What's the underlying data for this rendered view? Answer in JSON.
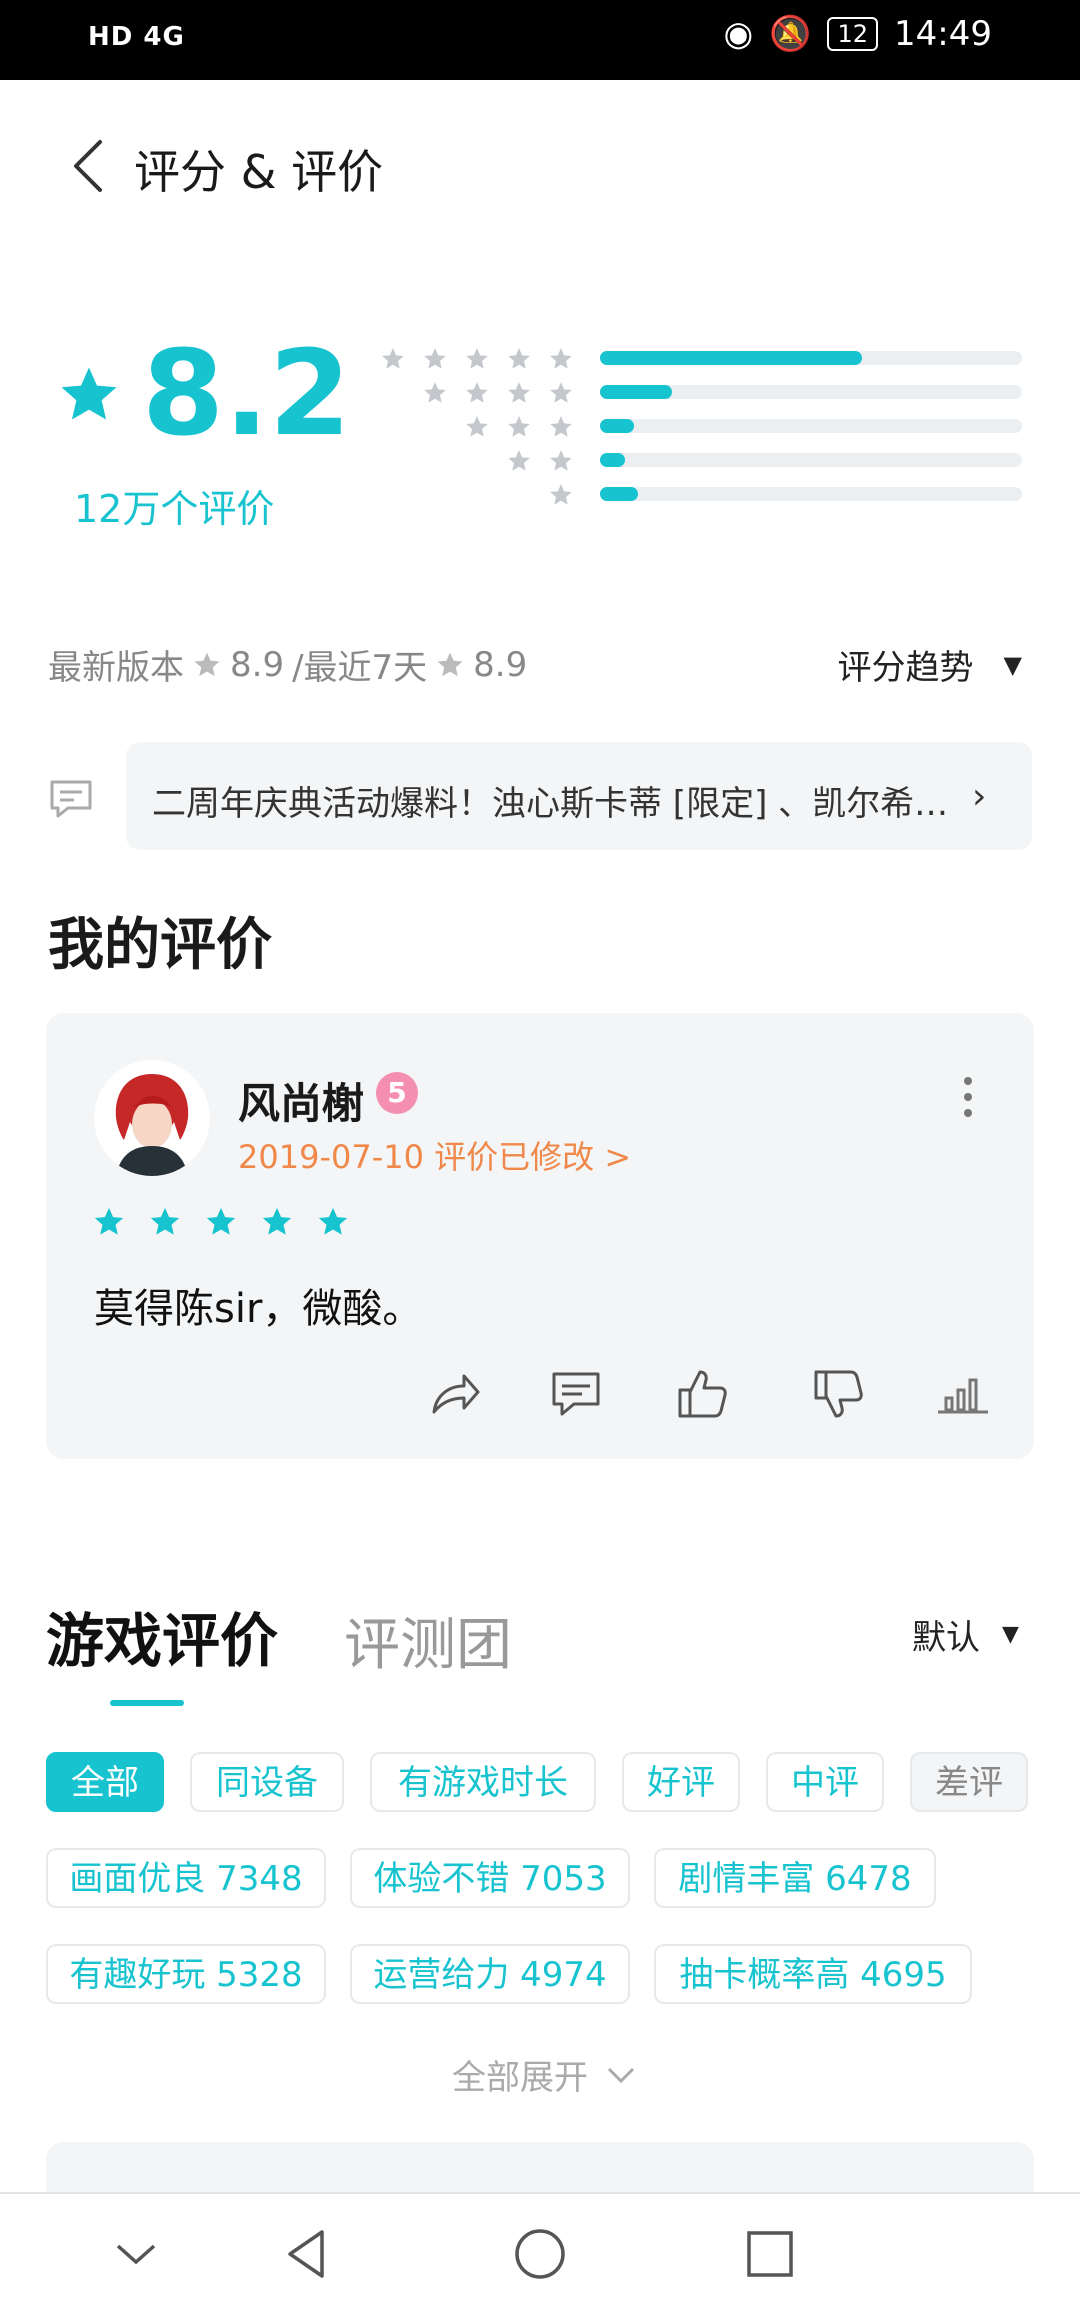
{
  "status_bar": {
    "left_indicators": "HD 4G",
    "battery": "12",
    "time": "14:49"
  },
  "header": {
    "title": "评分 & 评价"
  },
  "rating": {
    "score": "8.2",
    "count": "12万个评价",
    "distribution": [
      {
        "stars": 5,
        "fraction": 0.62
      },
      {
        "stars": 4,
        "fraction": 0.17
      },
      {
        "stars": 3,
        "fraction": 0.08
      },
      {
        "stars": 2,
        "fraction": 0.06
      },
      {
        "stars": 1,
        "fraction": 0.09
      }
    ]
  },
  "version_line": {
    "latest_label": "最新版本",
    "latest_score": "8.9",
    "recent_label": "/最近7天",
    "recent_score": "8.9",
    "trend_label": "评分趋势"
  },
  "announcement": {
    "text": "二周年庆典活动爆料！浊心斯卡蒂 [限定] 、凯尔希…"
  },
  "my_review": {
    "section_title": "我的评价",
    "username": "风尚榭",
    "level_badge": "5",
    "date_text": "2019-07-10 评价已修改 >",
    "stars": 5,
    "content": "莫得陈sir，微酸。"
  },
  "reviews_tabs": {
    "active": "游戏评价",
    "inactive": "评测团",
    "sort_label": "默认"
  },
  "filters": {
    "primary": [
      "全部",
      "同设备",
      "有游戏时长",
      "好评",
      "中评",
      "差评"
    ],
    "tags": [
      "画面优良 7348",
      "体验不错 7053",
      "剧情丰富 6478",
      "有趣好玩 5328",
      "运营给力 4974",
      "抽卡概率高 4695"
    ],
    "expand_label": "全部展开"
  },
  "colors": {
    "accent": "#17c3cf",
    "date_orange": "#f0884a",
    "badge_pink": "#f48fb1"
  }
}
